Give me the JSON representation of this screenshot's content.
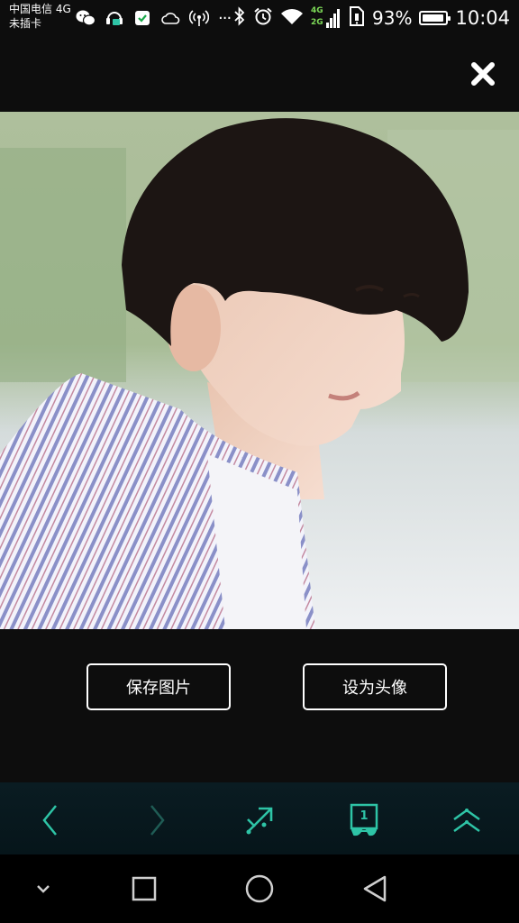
{
  "status_bar": {
    "carrier_line1": "中国电信 4G",
    "carrier_line2": "未插卡",
    "network_4g": "4G",
    "network_2g": "2G",
    "battery_percent": "93%",
    "battery_level": 0.93,
    "time": "10:04",
    "more_icon": "···"
  },
  "actions": {
    "save_image": "保存图片",
    "set_avatar": "设为头像"
  },
  "toolbar": {
    "tab_count": "1"
  },
  "icons": {
    "close": "close-icon",
    "back": "back-arrow-icon",
    "forward": "forward-arrow-icon",
    "share": "share-icon",
    "tabs": "tabs-icon",
    "menu": "chevron-up-menu-icon"
  },
  "colors": {
    "accent": "#2ec4a6",
    "background": "#0d0d0d"
  }
}
